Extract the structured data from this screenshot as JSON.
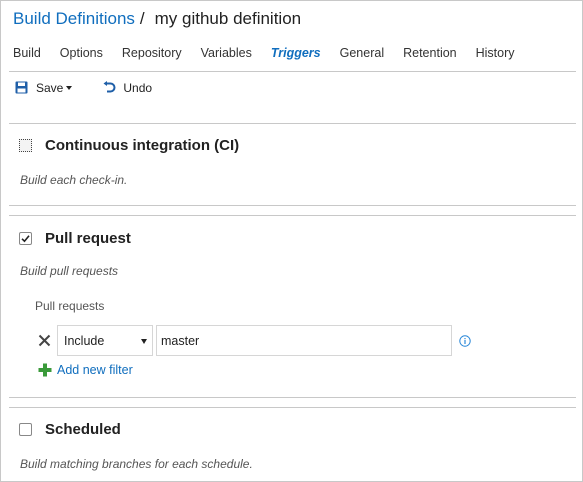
{
  "breadcrumb": {
    "parent": "Build Definitions",
    "separator": "/",
    "current": "my github definition"
  },
  "tabs": [
    {
      "label": "Build",
      "active": false
    },
    {
      "label": "Options",
      "active": false
    },
    {
      "label": "Repository",
      "active": false
    },
    {
      "label": "Variables",
      "active": false
    },
    {
      "label": "Triggers",
      "active": true
    },
    {
      "label": "General",
      "active": false
    },
    {
      "label": "Retention",
      "active": false
    },
    {
      "label": "History",
      "active": false
    }
  ],
  "toolbar": {
    "save_label": "Save",
    "undo_label": "Undo"
  },
  "sections": {
    "ci": {
      "title": "Continuous integration (CI)",
      "description": "Build each check-in.",
      "checked": false
    },
    "pr": {
      "title": "Pull request",
      "description": "Build pull requests",
      "checked": true,
      "sub_label": "Pull requests",
      "filter": {
        "type_value": "Include",
        "branch_value": "master"
      },
      "add_filter_label": "Add new filter"
    },
    "scheduled": {
      "title": "Scheduled",
      "description": "Build matching branches for each schedule.",
      "checked": false
    }
  },
  "colors": {
    "link": "#106ebe",
    "add_icon": "#3a9a3a",
    "info_icon": "#2b88d8",
    "divider": "#c8c8c8"
  },
  "icons": {
    "save": "floppy-disk-icon",
    "undo": "undo-arrow-icon",
    "remove": "close-x-icon",
    "add": "plus-icon",
    "info": "info-circle-icon"
  }
}
